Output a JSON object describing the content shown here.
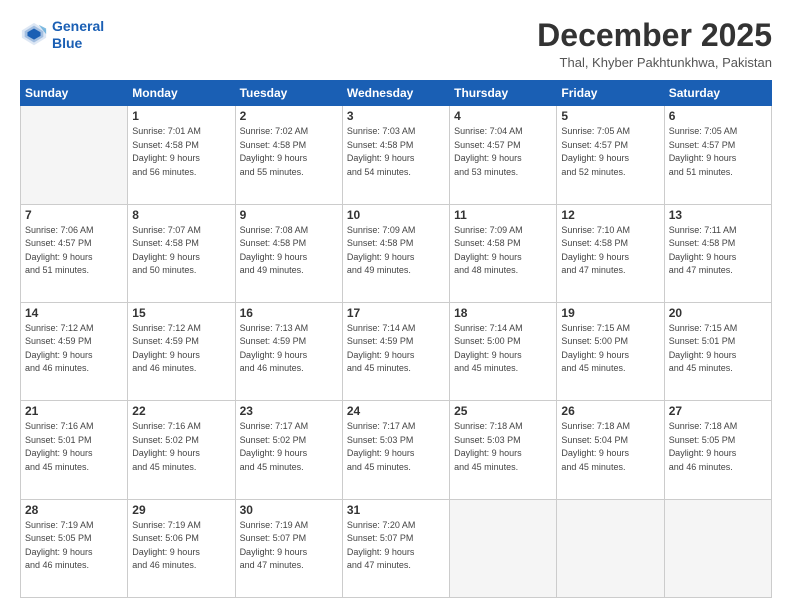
{
  "logo": {
    "line1": "General",
    "line2": "Blue"
  },
  "title": "December 2025",
  "subtitle": "Thal, Khyber Pakhtunkhwa, Pakistan",
  "days_header": [
    "Sunday",
    "Monday",
    "Tuesday",
    "Wednesday",
    "Thursday",
    "Friday",
    "Saturday"
  ],
  "weeks": [
    [
      {
        "num": "",
        "info": ""
      },
      {
        "num": "1",
        "info": "Sunrise: 7:01 AM\nSunset: 4:58 PM\nDaylight: 9 hours\nand 56 minutes."
      },
      {
        "num": "2",
        "info": "Sunrise: 7:02 AM\nSunset: 4:58 PM\nDaylight: 9 hours\nand 55 minutes."
      },
      {
        "num": "3",
        "info": "Sunrise: 7:03 AM\nSunset: 4:58 PM\nDaylight: 9 hours\nand 54 minutes."
      },
      {
        "num": "4",
        "info": "Sunrise: 7:04 AM\nSunset: 4:57 PM\nDaylight: 9 hours\nand 53 minutes."
      },
      {
        "num": "5",
        "info": "Sunrise: 7:05 AM\nSunset: 4:57 PM\nDaylight: 9 hours\nand 52 minutes."
      },
      {
        "num": "6",
        "info": "Sunrise: 7:05 AM\nSunset: 4:57 PM\nDaylight: 9 hours\nand 51 minutes."
      }
    ],
    [
      {
        "num": "7",
        "info": "Sunrise: 7:06 AM\nSunset: 4:57 PM\nDaylight: 9 hours\nand 51 minutes."
      },
      {
        "num": "8",
        "info": "Sunrise: 7:07 AM\nSunset: 4:58 PM\nDaylight: 9 hours\nand 50 minutes."
      },
      {
        "num": "9",
        "info": "Sunrise: 7:08 AM\nSunset: 4:58 PM\nDaylight: 9 hours\nand 49 minutes."
      },
      {
        "num": "10",
        "info": "Sunrise: 7:09 AM\nSunset: 4:58 PM\nDaylight: 9 hours\nand 49 minutes."
      },
      {
        "num": "11",
        "info": "Sunrise: 7:09 AM\nSunset: 4:58 PM\nDaylight: 9 hours\nand 48 minutes."
      },
      {
        "num": "12",
        "info": "Sunrise: 7:10 AM\nSunset: 4:58 PM\nDaylight: 9 hours\nand 47 minutes."
      },
      {
        "num": "13",
        "info": "Sunrise: 7:11 AM\nSunset: 4:58 PM\nDaylight: 9 hours\nand 47 minutes."
      }
    ],
    [
      {
        "num": "14",
        "info": "Sunrise: 7:12 AM\nSunset: 4:59 PM\nDaylight: 9 hours\nand 46 minutes."
      },
      {
        "num": "15",
        "info": "Sunrise: 7:12 AM\nSunset: 4:59 PM\nDaylight: 9 hours\nand 46 minutes."
      },
      {
        "num": "16",
        "info": "Sunrise: 7:13 AM\nSunset: 4:59 PM\nDaylight: 9 hours\nand 46 minutes."
      },
      {
        "num": "17",
        "info": "Sunrise: 7:14 AM\nSunset: 4:59 PM\nDaylight: 9 hours\nand 45 minutes."
      },
      {
        "num": "18",
        "info": "Sunrise: 7:14 AM\nSunset: 5:00 PM\nDaylight: 9 hours\nand 45 minutes."
      },
      {
        "num": "19",
        "info": "Sunrise: 7:15 AM\nSunset: 5:00 PM\nDaylight: 9 hours\nand 45 minutes."
      },
      {
        "num": "20",
        "info": "Sunrise: 7:15 AM\nSunset: 5:01 PM\nDaylight: 9 hours\nand 45 minutes."
      }
    ],
    [
      {
        "num": "21",
        "info": "Sunrise: 7:16 AM\nSunset: 5:01 PM\nDaylight: 9 hours\nand 45 minutes."
      },
      {
        "num": "22",
        "info": "Sunrise: 7:16 AM\nSunset: 5:02 PM\nDaylight: 9 hours\nand 45 minutes."
      },
      {
        "num": "23",
        "info": "Sunrise: 7:17 AM\nSunset: 5:02 PM\nDaylight: 9 hours\nand 45 minutes."
      },
      {
        "num": "24",
        "info": "Sunrise: 7:17 AM\nSunset: 5:03 PM\nDaylight: 9 hours\nand 45 minutes."
      },
      {
        "num": "25",
        "info": "Sunrise: 7:18 AM\nSunset: 5:03 PM\nDaylight: 9 hours\nand 45 minutes."
      },
      {
        "num": "26",
        "info": "Sunrise: 7:18 AM\nSunset: 5:04 PM\nDaylight: 9 hours\nand 45 minutes."
      },
      {
        "num": "27",
        "info": "Sunrise: 7:18 AM\nSunset: 5:05 PM\nDaylight: 9 hours\nand 46 minutes."
      }
    ],
    [
      {
        "num": "28",
        "info": "Sunrise: 7:19 AM\nSunset: 5:05 PM\nDaylight: 9 hours\nand 46 minutes."
      },
      {
        "num": "29",
        "info": "Sunrise: 7:19 AM\nSunset: 5:06 PM\nDaylight: 9 hours\nand 46 minutes."
      },
      {
        "num": "30",
        "info": "Sunrise: 7:19 AM\nSunset: 5:07 PM\nDaylight: 9 hours\nand 47 minutes."
      },
      {
        "num": "31",
        "info": "Sunrise: 7:20 AM\nSunset: 5:07 PM\nDaylight: 9 hours\nand 47 minutes."
      },
      {
        "num": "",
        "info": ""
      },
      {
        "num": "",
        "info": ""
      },
      {
        "num": "",
        "info": ""
      }
    ]
  ]
}
